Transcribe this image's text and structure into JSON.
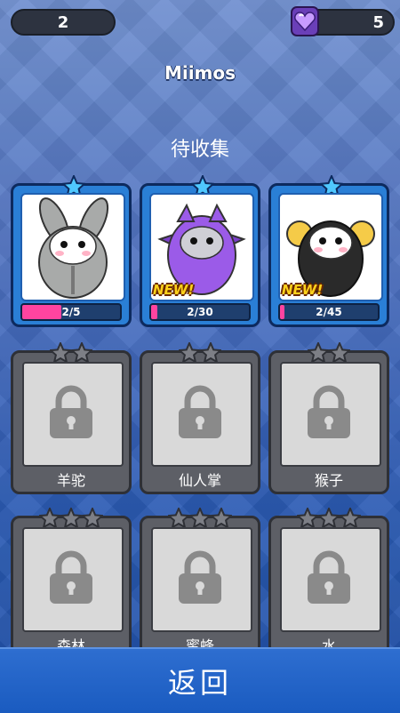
{
  "hud": {
    "score": "2",
    "gems": "5"
  },
  "title": "Miimos",
  "section_header": "待收集",
  "unlocked": [
    {
      "progress": "2/5",
      "progress_value": 0.4,
      "is_new": false,
      "new_label": ""
    },
    {
      "progress": "2/30",
      "progress_value": 0.0667,
      "is_new": true,
      "new_label": "NEW!"
    },
    {
      "progress": "2/45",
      "progress_value": 0.0444,
      "is_new": true,
      "new_label": "NEW!"
    }
  ],
  "locked": [
    {
      "name": "羊驼",
      "stars": 2
    },
    {
      "name": "仙人掌",
      "stars": 2
    },
    {
      "name": "猴子",
      "stars": 2
    },
    {
      "name": "森林",
      "stars": 3
    },
    {
      "name": "蜜蜂",
      "stars": 3
    },
    {
      "name": "水",
      "stars": 3
    }
  ],
  "footer": {
    "back_label": "返回"
  },
  "colors": {
    "accent_pink": "#ff44a0",
    "new_badge": "#ffd21c",
    "card_blue": "#2a7fd6"
  }
}
